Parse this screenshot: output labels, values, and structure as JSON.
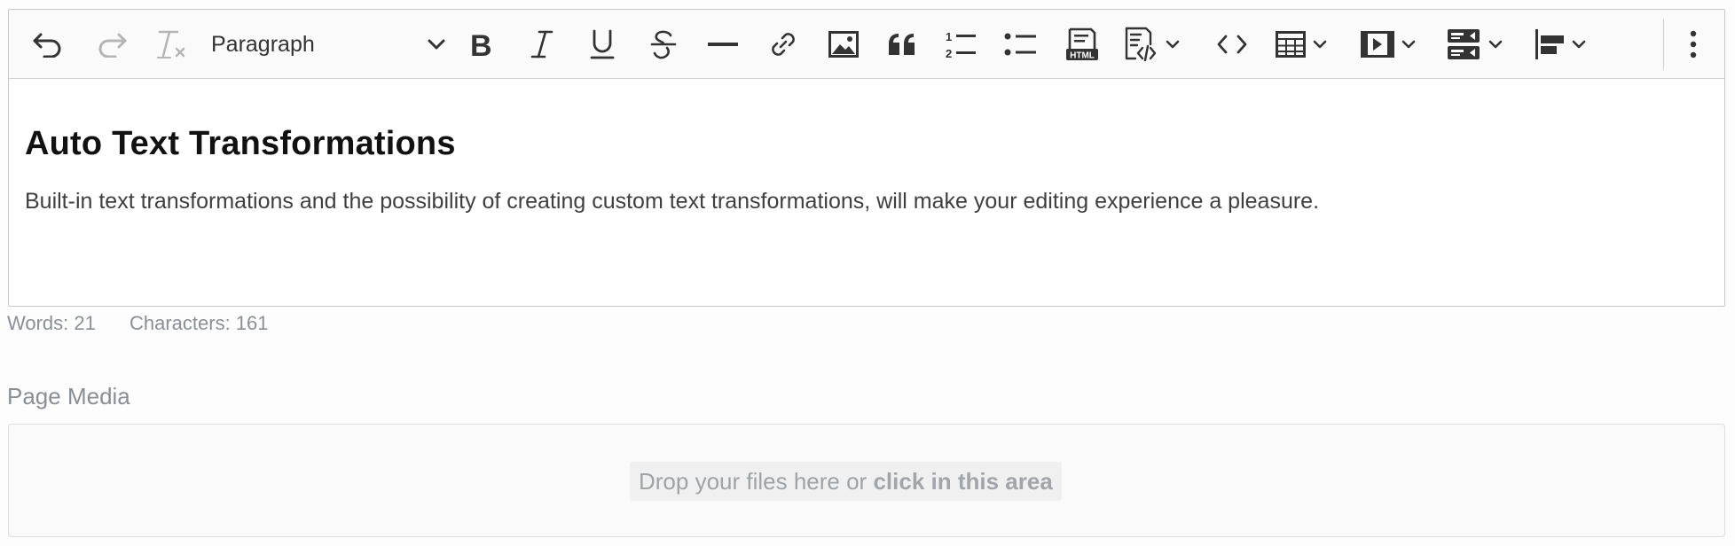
{
  "toolbar": {
    "heading_select": {
      "selected": "Paragraph",
      "icon": "chevron-down-icon"
    },
    "buttons": [
      {
        "name": "undo",
        "icon": "undo-icon"
      },
      {
        "name": "redo",
        "icon": "redo-icon"
      },
      {
        "name": "remove-format",
        "icon": "remove-format-icon"
      },
      {
        "name": "bold",
        "icon": "bold-icon"
      },
      {
        "name": "italic",
        "icon": "italic-icon"
      },
      {
        "name": "underline",
        "icon": "underline-icon"
      },
      {
        "name": "strikethrough",
        "icon": "strikethrough-icon"
      },
      {
        "name": "horizontal-line",
        "icon": "horizontal-line-icon"
      },
      {
        "name": "link",
        "icon": "link-icon"
      },
      {
        "name": "insert-image",
        "icon": "image-icon"
      },
      {
        "name": "block-quote",
        "icon": "quote-icon"
      },
      {
        "name": "numbered-list",
        "icon": "numbered-list-icon"
      },
      {
        "name": "bulleted-list",
        "icon": "bulleted-list-icon"
      },
      {
        "name": "html-embed",
        "icon": "html-icon"
      },
      {
        "name": "code-block",
        "icon": "code-block-icon"
      },
      {
        "name": "source-code",
        "icon": "code-icon"
      },
      {
        "name": "insert-table",
        "icon": "table-icon"
      },
      {
        "name": "insert-media",
        "icon": "media-icon"
      },
      {
        "name": "templates",
        "icon": "template-icon"
      },
      {
        "name": "alignment",
        "icon": "align-left-icon"
      },
      {
        "name": "more",
        "icon": "more-vertical-icon"
      }
    ],
    "html_badge": "HTML"
  },
  "content": {
    "heading": "Auto Text Transformations",
    "paragraph": "Built-in text transformations and the possibility of creating custom text transformations, will make your editing experience a pleasure."
  },
  "word_count": {
    "words": "Words: 21",
    "characters": "Characters: 161"
  },
  "media": {
    "label": "Page Media",
    "drop_text": "Drop your files here or ",
    "drop_link": "click in this area"
  },
  "colors": {
    "icon": "#333333",
    "icon_disabled": "#b5b5b5",
    "muted_text": "#8a8f96"
  }
}
